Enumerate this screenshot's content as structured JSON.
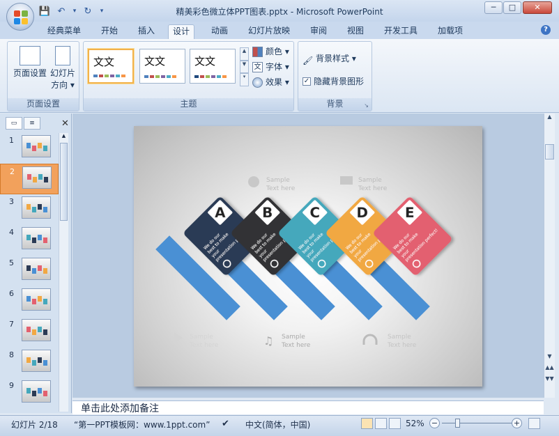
{
  "window": {
    "title": "精美彩色微立体PPT图表.pptx - Microsoft PowerPoint",
    "minimize": "─",
    "maximize": "□",
    "close": "✕"
  },
  "qat": {
    "save": "💾",
    "undo": "↶",
    "undo_dd": "▾",
    "redo": "↻",
    "customize": "▾"
  },
  "tabs": [
    "经典菜单",
    "开始",
    "插入",
    "设计",
    "动画",
    "幻灯片放映",
    "审阅",
    "视图",
    "开发工具",
    "加载项"
  ],
  "active_tab": "设计",
  "help": "?",
  "ribbon": {
    "page_setup": {
      "label": "页面设置",
      "page_setup_btn": "页面设置",
      "orientation_btn_line1": "幻灯片",
      "orientation_btn_line2": "方向 ▾"
    },
    "themes": {
      "label": "主题",
      "items": [
        "文文",
        "文文",
        "文文"
      ],
      "colors": "颜色 ▾",
      "fonts": "字体 ▾",
      "effects": "效果 ▾"
    },
    "background": {
      "label": "背景",
      "styles": "背景样式 ▾",
      "hide_graphics": "隐藏背景图形",
      "hide_checked": true
    }
  },
  "slides": [
    "1",
    "2",
    "3",
    "4",
    "5",
    "6",
    "7",
    "8",
    "9"
  ],
  "selected_slide": "2",
  "slide": {
    "sample": "Sample",
    "text_here": "Text here",
    "body": "We do our best to make your presentation perfect!",
    "letters": [
      "A",
      "B",
      "C",
      "D",
      "E"
    ],
    "card_colors": [
      "#2c3b55",
      "#333335",
      "#45a8bc",
      "#f1a843",
      "#e3616f"
    ],
    "bar_color": "#4a90d4"
  },
  "notes_placeholder": "单击此处添加备注",
  "status": {
    "slide_label": "幻灯片 2/18",
    "theme_name": "“第一PPT模板网：www.1ppt.com”",
    "language": "中文(简体，中国)",
    "zoom": "52%",
    "zoom_minus": "−",
    "zoom_plus": "+"
  }
}
